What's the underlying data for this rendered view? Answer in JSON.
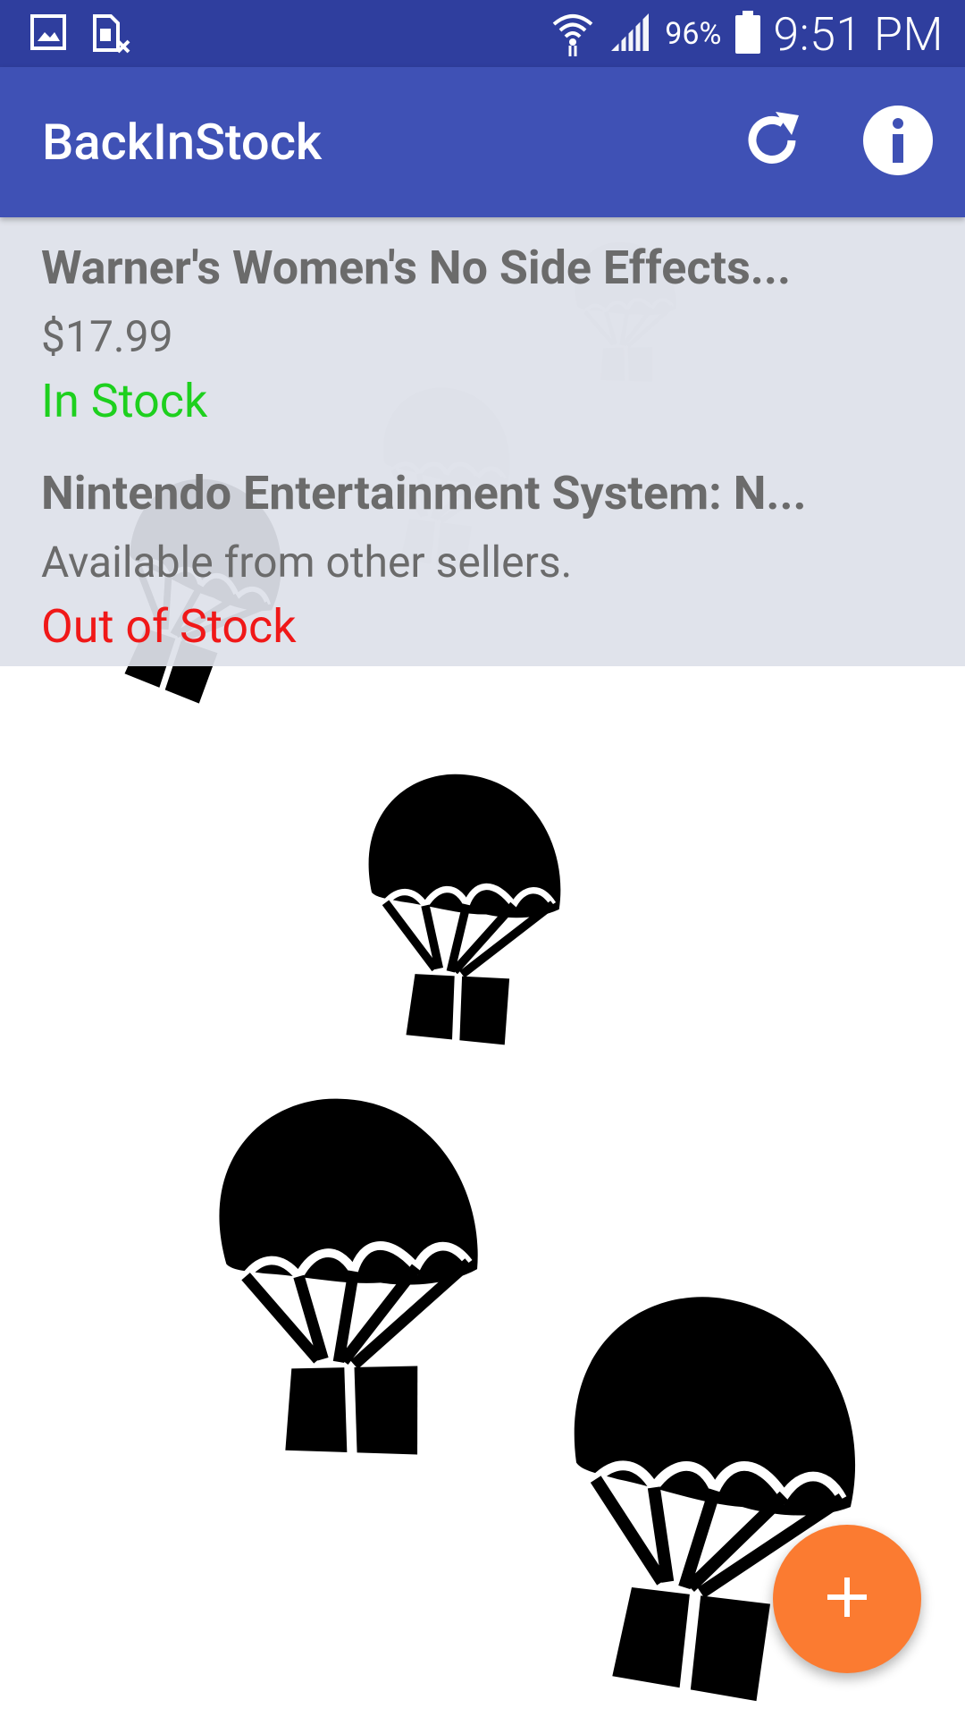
{
  "status_bar": {
    "battery_percent": "96%",
    "time": "9:51 PM",
    "icons": [
      "gallery-icon",
      "sim-card-disabled-icon",
      "wifi-icon",
      "signal-icon",
      "battery-icon"
    ]
  },
  "app_bar": {
    "title": "BackInStock",
    "actions": [
      "refresh-icon",
      "info-icon"
    ]
  },
  "products": [
    {
      "title": "Warner's Women's No Side Effects...",
      "detail": "$17.99",
      "status": "In Stock"
    },
    {
      "title": "Nintendo Entertainment System: N...",
      "detail": "Available from other sellers.",
      "status": "Out of Stock"
    }
  ],
  "colors": {
    "status_bar": "#2f3e9e",
    "app_bar": "#3f51b5",
    "in_stock": "#1ed01e",
    "out_of_stock": "#f01818",
    "fab": "#fb7b31"
  },
  "fab": {
    "icon": "plus-icon"
  }
}
